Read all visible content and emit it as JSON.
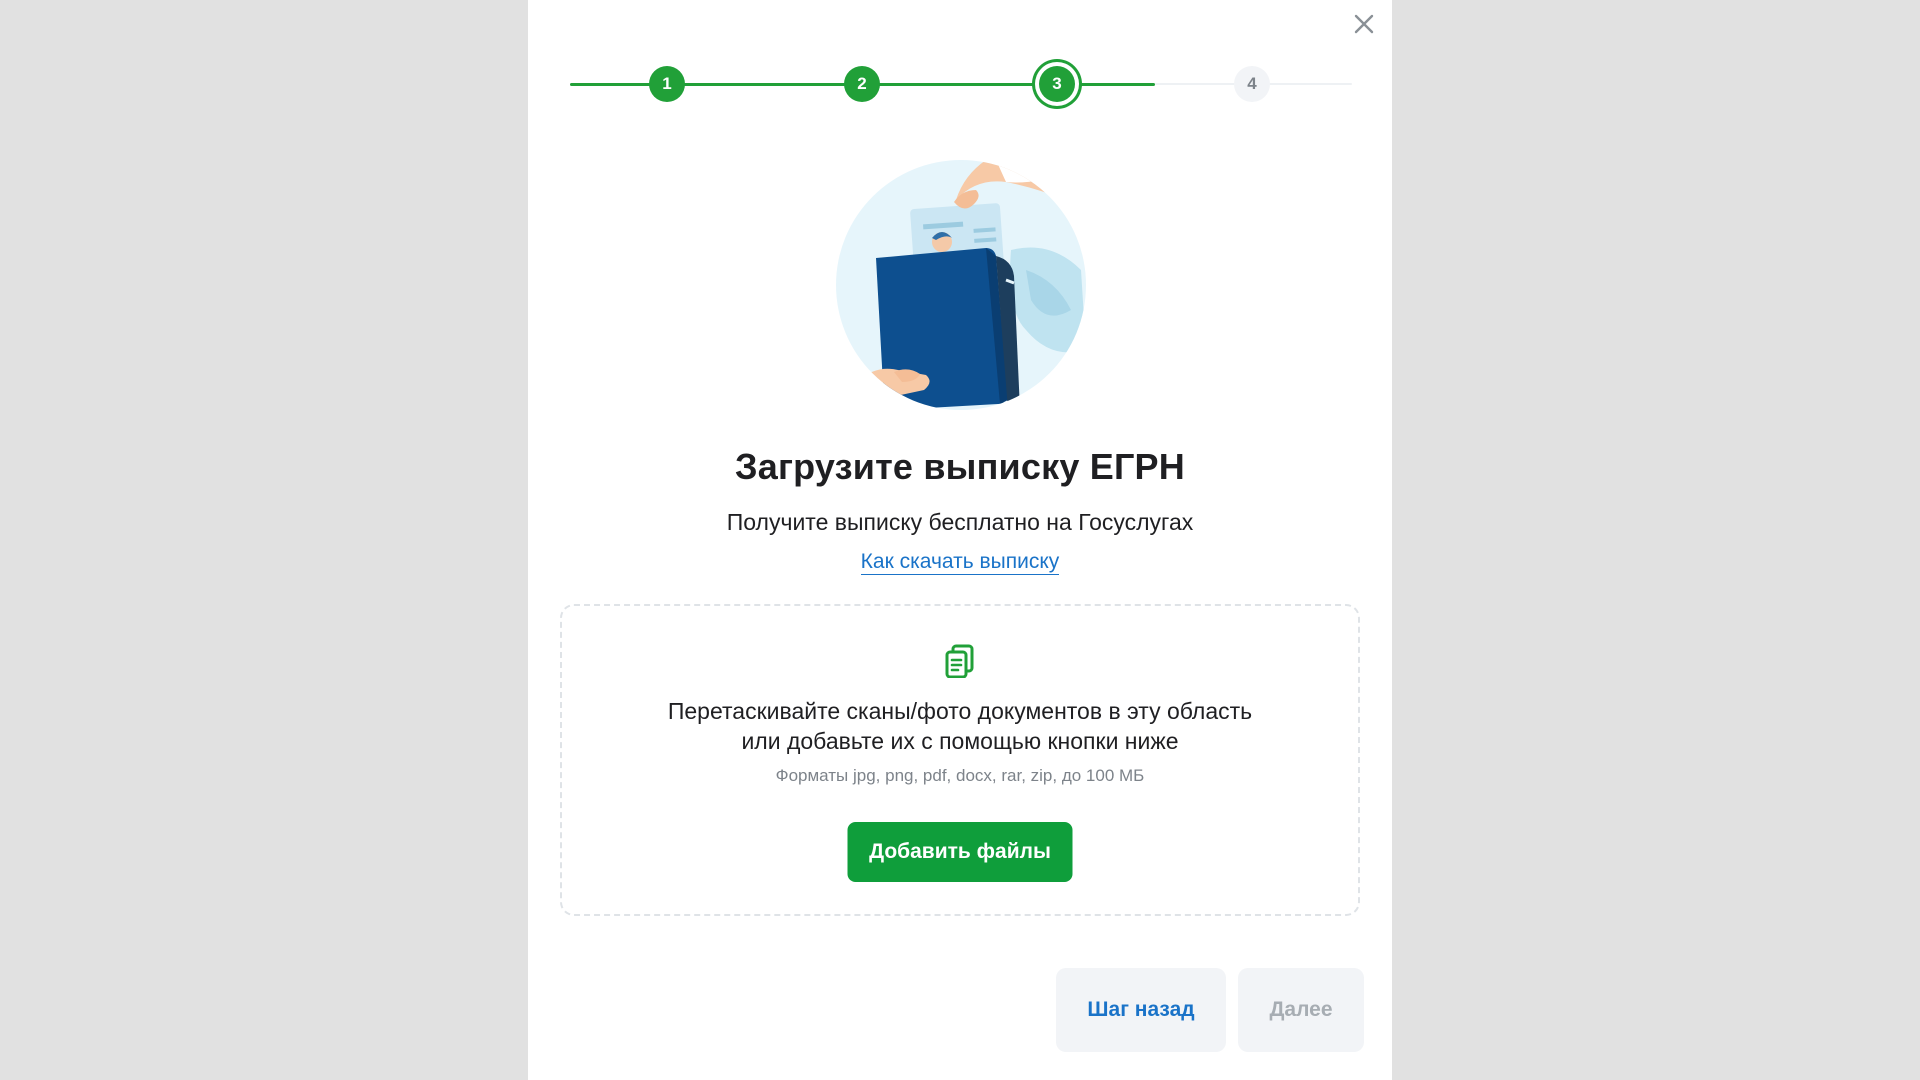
{
  "modal": {
    "close_icon": "close-icon"
  },
  "stepper": {
    "steps": [
      {
        "label": "1",
        "state": "done"
      },
      {
        "label": "2",
        "state": "done"
      },
      {
        "label": "3",
        "state": "current"
      },
      {
        "label": "4",
        "state": "todo"
      }
    ]
  },
  "content": {
    "illustration": "passport-document-illustration",
    "title": "Загрузите выписку ЕГРН",
    "subtitle": "Получите выписку бесплатно на Госуслугах",
    "help_link": "Как скачать выписку"
  },
  "dropzone": {
    "icon": "document-icon",
    "line1": "Перетаскивайте сканы/фото документов в эту область",
    "line2": "или добавьте их с помощью кнопки ниже",
    "formats": "Форматы jpg, png, pdf, docx, rar, zip, до 100 МБ",
    "add_button": "Добавить файлы"
  },
  "footer": {
    "back_button": "Шаг назад",
    "next_button": "Далее",
    "next_disabled": true
  },
  "colors": {
    "accent_green": "#21a038",
    "button_green": "#0f9e3b",
    "link_blue": "#1a73c8",
    "disabled_text": "#a7adb3"
  }
}
